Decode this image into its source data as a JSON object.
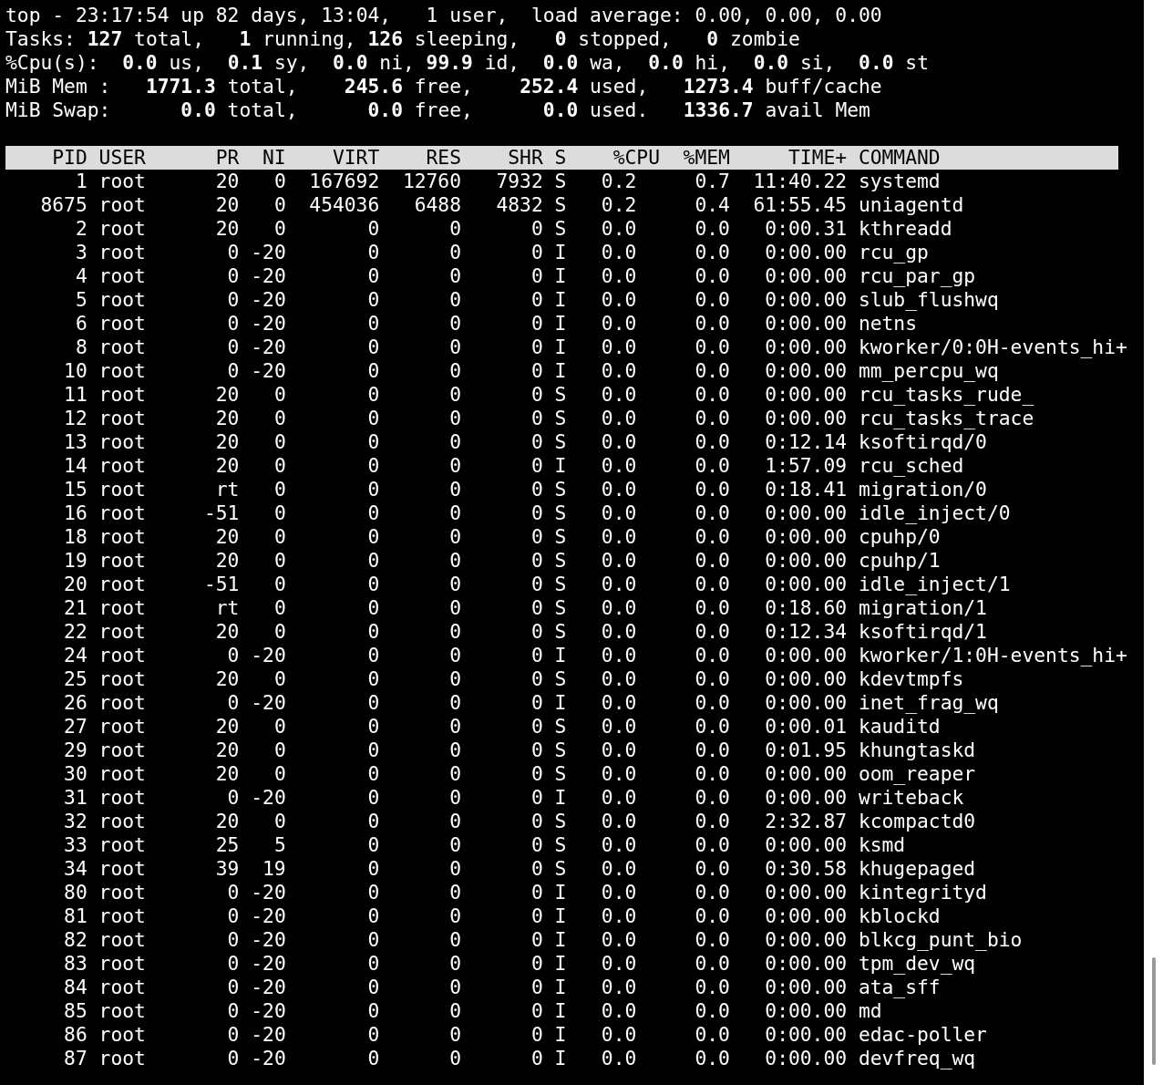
{
  "summary_lines": [
    "top - 23:17:54 up 82 days, 13:04,   1 user,  load average: 0.00, 0.00, 0.00",
    "Tasks: **127** total,   **1** running, **126** sleeping,   **0** stopped,   **0** zombie",
    "%Cpu(s):  **0.0** us,  **0.1** sy,  **0.0** ni, **99.9** id,  **0.0** wa,  **0.0** hi,  **0.0** si,  **0.0** st",
    "MiB Mem :   **1771.3** total,    **245.6** free,    **252.4** used,   **1273.4** buff/cache",
    "MiB Swap:      **0.0** total,      **0.0** free,      **0.0** used.   **1336.7** avail Mem"
  ],
  "table": {
    "columns": [
      "PID",
      "USER",
      "PR",
      "NI",
      "VIRT",
      "RES",
      "SHR",
      "S",
      "%CPU",
      "%MEM",
      "TIME+",
      "COMMAND"
    ],
    "rows": [
      [
        "1",
        "root",
        "20",
        "0",
        "167692",
        "12760",
        "7932",
        "S",
        "0.2",
        "0.7",
        "11:40.22",
        "systemd"
      ],
      [
        "8675",
        "root",
        "20",
        "0",
        "454036",
        "6488",
        "4832",
        "S",
        "0.2",
        "0.4",
        "61:55.45",
        "uniagentd"
      ],
      [
        "2",
        "root",
        "20",
        "0",
        "0",
        "0",
        "0",
        "S",
        "0.0",
        "0.0",
        "0:00.31",
        "kthreadd"
      ],
      [
        "3",
        "root",
        "0",
        "-20",
        "0",
        "0",
        "0",
        "I",
        "0.0",
        "0.0",
        "0:00.00",
        "rcu_gp"
      ],
      [
        "4",
        "root",
        "0",
        "-20",
        "0",
        "0",
        "0",
        "I",
        "0.0",
        "0.0",
        "0:00.00",
        "rcu_par_gp"
      ],
      [
        "5",
        "root",
        "0",
        "-20",
        "0",
        "0",
        "0",
        "I",
        "0.0",
        "0.0",
        "0:00.00",
        "slub_flushwq"
      ],
      [
        "6",
        "root",
        "0",
        "-20",
        "0",
        "0",
        "0",
        "I",
        "0.0",
        "0.0",
        "0:00.00",
        "netns"
      ],
      [
        "8",
        "root",
        "0",
        "-20",
        "0",
        "0",
        "0",
        "I",
        "0.0",
        "0.0",
        "0:00.00",
        "kworker/0:0H-events_hi+"
      ],
      [
        "10",
        "root",
        "0",
        "-20",
        "0",
        "0",
        "0",
        "I",
        "0.0",
        "0.0",
        "0:00.00",
        "mm_percpu_wq"
      ],
      [
        "11",
        "root",
        "20",
        "0",
        "0",
        "0",
        "0",
        "S",
        "0.0",
        "0.0",
        "0:00.00",
        "rcu_tasks_rude_"
      ],
      [
        "12",
        "root",
        "20",
        "0",
        "0",
        "0",
        "0",
        "S",
        "0.0",
        "0.0",
        "0:00.00",
        "rcu_tasks_trace"
      ],
      [
        "13",
        "root",
        "20",
        "0",
        "0",
        "0",
        "0",
        "S",
        "0.0",
        "0.0",
        "0:12.14",
        "ksoftirqd/0"
      ],
      [
        "14",
        "root",
        "20",
        "0",
        "0",
        "0",
        "0",
        "I",
        "0.0",
        "0.0",
        "1:57.09",
        "rcu_sched"
      ],
      [
        "15",
        "root",
        "rt",
        "0",
        "0",
        "0",
        "0",
        "S",
        "0.0",
        "0.0",
        "0:18.41",
        "migration/0"
      ],
      [
        "16",
        "root",
        "-51",
        "0",
        "0",
        "0",
        "0",
        "S",
        "0.0",
        "0.0",
        "0:00.00",
        "idle_inject/0"
      ],
      [
        "18",
        "root",
        "20",
        "0",
        "0",
        "0",
        "0",
        "S",
        "0.0",
        "0.0",
        "0:00.00",
        "cpuhp/0"
      ],
      [
        "19",
        "root",
        "20",
        "0",
        "0",
        "0",
        "0",
        "S",
        "0.0",
        "0.0",
        "0:00.00",
        "cpuhp/1"
      ],
      [
        "20",
        "root",
        "-51",
        "0",
        "0",
        "0",
        "0",
        "S",
        "0.0",
        "0.0",
        "0:00.00",
        "idle_inject/1"
      ],
      [
        "21",
        "root",
        "rt",
        "0",
        "0",
        "0",
        "0",
        "S",
        "0.0",
        "0.0",
        "0:18.60",
        "migration/1"
      ],
      [
        "22",
        "root",
        "20",
        "0",
        "0",
        "0",
        "0",
        "S",
        "0.0",
        "0.0",
        "0:12.34",
        "ksoftirqd/1"
      ],
      [
        "24",
        "root",
        "0",
        "-20",
        "0",
        "0",
        "0",
        "I",
        "0.0",
        "0.0",
        "0:00.00",
        "kworker/1:0H-events_hi+"
      ],
      [
        "25",
        "root",
        "20",
        "0",
        "0",
        "0",
        "0",
        "S",
        "0.0",
        "0.0",
        "0:00.00",
        "kdevtmpfs"
      ],
      [
        "26",
        "root",
        "0",
        "-20",
        "0",
        "0",
        "0",
        "I",
        "0.0",
        "0.0",
        "0:00.00",
        "inet_frag_wq"
      ],
      [
        "27",
        "root",
        "20",
        "0",
        "0",
        "0",
        "0",
        "S",
        "0.0",
        "0.0",
        "0:00.01",
        "kauditd"
      ],
      [
        "29",
        "root",
        "20",
        "0",
        "0",
        "0",
        "0",
        "S",
        "0.0",
        "0.0",
        "0:01.95",
        "khungtaskd"
      ],
      [
        "30",
        "root",
        "20",
        "0",
        "0",
        "0",
        "0",
        "S",
        "0.0",
        "0.0",
        "0:00.00",
        "oom_reaper"
      ],
      [
        "31",
        "root",
        "0",
        "-20",
        "0",
        "0",
        "0",
        "I",
        "0.0",
        "0.0",
        "0:00.00",
        "writeback"
      ],
      [
        "32",
        "root",
        "20",
        "0",
        "0",
        "0",
        "0",
        "S",
        "0.0",
        "0.0",
        "2:32.87",
        "kcompactd0"
      ],
      [
        "33",
        "root",
        "25",
        "5",
        "0",
        "0",
        "0",
        "S",
        "0.0",
        "0.0",
        "0:00.00",
        "ksmd"
      ],
      [
        "34",
        "root",
        "39",
        "19",
        "0",
        "0",
        "0",
        "S",
        "0.0",
        "0.0",
        "0:30.58",
        "khugepaged"
      ],
      [
        "80",
        "root",
        "0",
        "-20",
        "0",
        "0",
        "0",
        "I",
        "0.0",
        "0.0",
        "0:00.00",
        "kintegrityd"
      ],
      [
        "81",
        "root",
        "0",
        "-20",
        "0",
        "0",
        "0",
        "I",
        "0.0",
        "0.0",
        "0:00.00",
        "kblockd"
      ],
      [
        "82",
        "root",
        "0",
        "-20",
        "0",
        "0",
        "0",
        "I",
        "0.0",
        "0.0",
        "0:00.00",
        "blkcg_punt_bio"
      ],
      [
        "83",
        "root",
        "0",
        "-20",
        "0",
        "0",
        "0",
        "I",
        "0.0",
        "0.0",
        "0:00.00",
        "tpm_dev_wq"
      ],
      [
        "84",
        "root",
        "0",
        "-20",
        "0",
        "0",
        "0",
        "I",
        "0.0",
        "0.0",
        "0:00.00",
        "ata_sff"
      ],
      [
        "85",
        "root",
        "0",
        "-20",
        "0",
        "0",
        "0",
        "I",
        "0.0",
        "0.0",
        "0:00.00",
        "md"
      ],
      [
        "86",
        "root",
        "0",
        "-20",
        "0",
        "0",
        "0",
        "I",
        "0.0",
        "0.0",
        "0:00.00",
        "edac-poller"
      ],
      [
        "87",
        "root",
        "0",
        "-20",
        "0",
        "0",
        "0",
        "I",
        "0.0",
        "0.0",
        "0:00.00",
        "devfreq_wq"
      ]
    ]
  }
}
